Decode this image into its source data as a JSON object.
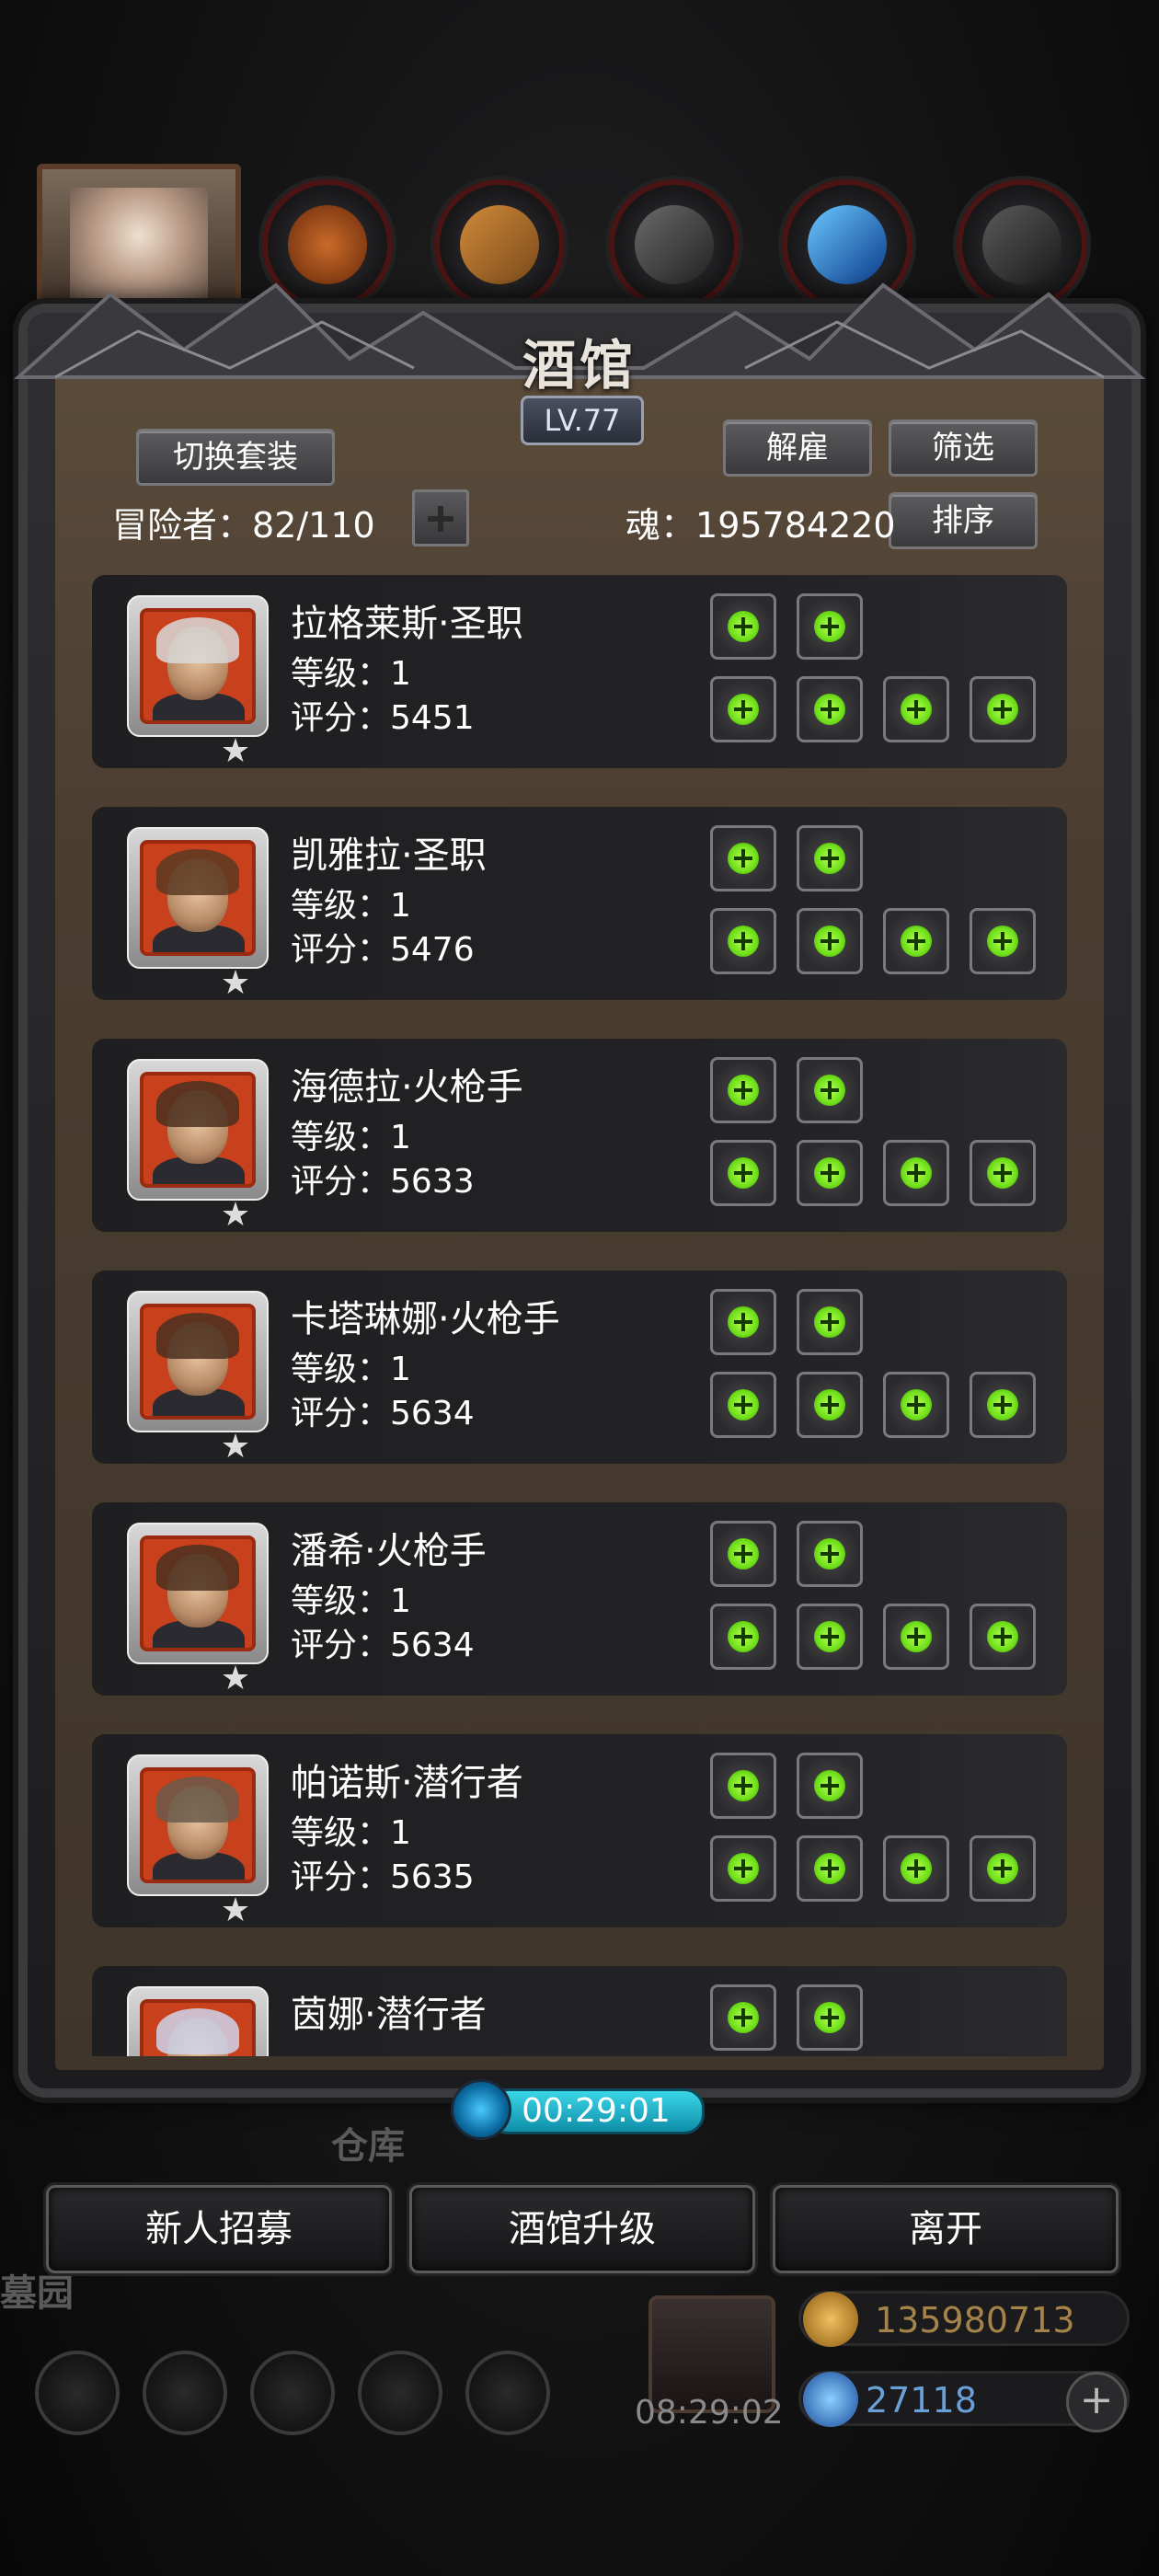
{
  "title": "酒馆",
  "level": "LV.77",
  "buttons": {
    "switch_outfit": "切换套装",
    "dismiss": "解雇",
    "filter": "筛选",
    "sort": "排序"
  },
  "adventurers": {
    "label": "冒险者：",
    "value": "82/110"
  },
  "soul": {
    "label": "魂：",
    "value": "195784220"
  },
  "heroes": [
    {
      "name": "拉格莱斯·圣职",
      "level": "等级：1",
      "score": "评分：5451"
    },
    {
      "name": "凯雅拉·圣职",
      "level": "等级：1",
      "score": "评分：5476"
    },
    {
      "name": "海德拉·火枪手",
      "level": "等级：1",
      "score": "评分：5633"
    },
    {
      "name": "卡塔琳娜·火枪手",
      "level": "等级：1",
      "score": "评分：5634"
    },
    {
      "name": "潘希·火枪手",
      "level": "等级：1",
      "score": "评分：5634"
    },
    {
      "name": "帕诺斯·潜行者",
      "level": "等级：1",
      "score": "评分：5635"
    },
    {
      "name": "茵娜·潜行者",
      "level": "",
      "score": ""
    }
  ],
  "star_glyph": "★",
  "timer": "00:29:01",
  "bottom_buttons": {
    "recruit": "新人招募",
    "upgrade": "酒馆升级",
    "leave": "离开"
  },
  "background": {
    "warehouse": "仓库",
    "garden": "墓园",
    "gift_timer": "08:29:02"
  },
  "resources": {
    "gold": "135980713",
    "gems": "27118"
  },
  "colors": {
    "accent_green": "#6fe01a",
    "timer_cyan": "#3ad6e8",
    "gold_text": "#a5844a"
  }
}
